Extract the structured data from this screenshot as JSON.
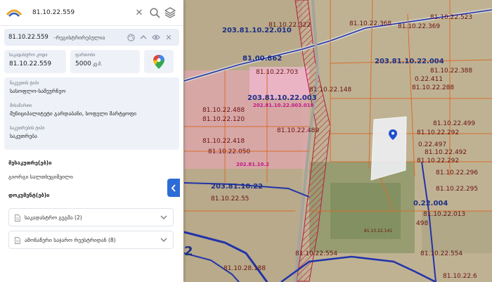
{
  "search": {
    "value": "81.10.22.559"
  },
  "header": {
    "cadastral": "81.10.22.559",
    "status": "-რეგისტრირებულია"
  },
  "fields": {
    "cadastral_label": "საკადასტრო კოდი",
    "cadastral_value": "81.10.22.559",
    "area_label": "ფართობი",
    "area_value": "5000",
    "area_unit": "კვ.მ."
  },
  "info": {
    "land_type_label": "ნაკვეთის ტიპი",
    "land_type_value": "სასოფლო-სამეურნეო",
    "address_label": "მისამართი",
    "address_value": "მუნიციპალიტეტი გარდაბანი, სოფელი მარტყოფი",
    "ownership_label": "საკუთრების ტიპი",
    "ownership_value": "საკუთრება"
  },
  "owners": {
    "title": "მესაკუთრე(ებ)ი",
    "name": "გიორგი სალთხუციშვილი"
  },
  "documents": {
    "title": "დოკუმენტ(ებ)ი",
    "items": [
      {
        "label": "საკადასტრო გეგმა (2)"
      },
      {
        "label": "ამონაწერი საჯარო რეესტრიდან (8)"
      }
    ]
  },
  "map": {
    "labels": [
      "203.81.10.22.010",
      "81.10.22.322",
      "81.10.22.368",
      "81.10.22.369",
      "81.10.22.523",
      "81.00.862",
      "81.10.22.703",
      "203.81.10.22.004",
      "81.10.22.388",
      "0.22.411",
      "81.10.22.288",
      "81.10.22.148",
      "203.81.10.22.003",
      "202.81.10.22.003.018",
      "81.10.22.488",
      "81.10.22.120",
      "81.10.22.489",
      "81.10.22.499",
      "81.10.22.292",
      "0.22.497",
      "81.10.22.418",
      "81.10.22.050",
      "202.81.10.2",
      "81.10.22.492",
      "81.10.22.292",
      "203.81.10.22",
      "81.10.22.55",
      "81.10.22.296",
      "81.10.22.295",
      "0.22.004",
      "81.10.22.013",
      "498",
      "81.10.22.554",
      "81.10.22.554",
      "81.10.28.188",
      "81.10.22.141",
      "2",
      "81.10.22.6"
    ]
  }
}
